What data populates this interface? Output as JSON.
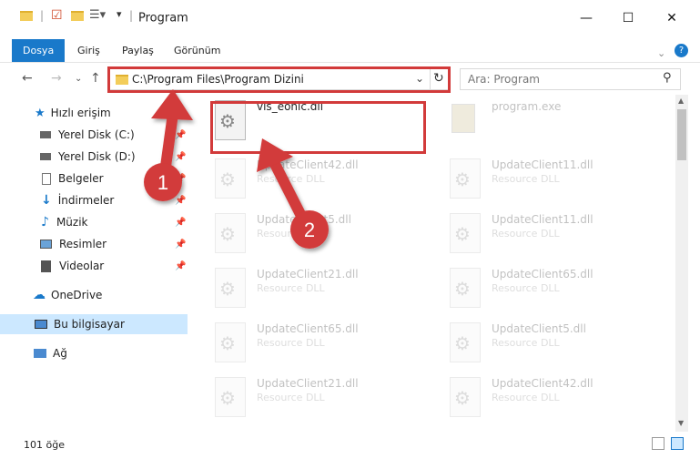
{
  "window": {
    "title": "Program",
    "minimize": "—",
    "maximize": "☐",
    "close": "✕"
  },
  "ribbon": {
    "tabs": [
      "Dosya",
      "Giriş",
      "Paylaş",
      "Görünüm"
    ],
    "help": "?"
  },
  "address": {
    "path": "C:\\Program Files\\Program Dizini",
    "refresh": "↻",
    "search_placeholder": "Ara: Program"
  },
  "sidebar": {
    "items": [
      {
        "label": "Hızlı erişim",
        "icon": "star-icon"
      },
      {
        "label": "Yerel Disk (C:)",
        "icon": "drive-icon",
        "pinned": true
      },
      {
        "label": "Yerel Disk (D:)",
        "icon": "drive-icon",
        "pinned": true
      },
      {
        "label": "Belgeler",
        "icon": "documents-icon",
        "pinned": true
      },
      {
        "label": "İndirmeler",
        "icon": "downloads-icon",
        "pinned": true
      },
      {
        "label": "Müzik",
        "icon": "music-icon",
        "pinned": true
      },
      {
        "label": "Resimler",
        "icon": "pictures-icon",
        "pinned": true
      },
      {
        "label": "Videolar",
        "icon": "videos-icon",
        "pinned": true
      },
      {
        "label": "OneDrive",
        "icon": "cloud-icon"
      },
      {
        "label": "Bu bilgisayar",
        "icon": "computer-icon",
        "selected": true
      },
      {
        "label": "Ağ",
        "icon": "network-icon"
      }
    ]
  },
  "files": [
    {
      "name": "vis_eonic.dll",
      "type": ""
    },
    {
      "name": "program.exe",
      "type": ""
    },
    {
      "name": "UpdateClient42.dll",
      "type": "Resource DLL"
    },
    {
      "name": "UpdateClient11.dll",
      "type": "Resource DLL"
    },
    {
      "name": "UpdateClient5.dll",
      "type": "Resource DLL"
    },
    {
      "name": "UpdateClient11.dll",
      "type": "Resource DLL"
    },
    {
      "name": "UpdateClient21.dll",
      "type": "Resource DLL"
    },
    {
      "name": "UpdateClient65.dll",
      "type": "Resource DLL"
    },
    {
      "name": "UpdateClient65.dll",
      "type": "Resource DLL"
    },
    {
      "name": "UpdateClient5.dll",
      "type": "Resource DLL"
    },
    {
      "name": "UpdateClient21.dll",
      "type": "Resource DLL"
    },
    {
      "name": "UpdateClient42.dll",
      "type": "Resource DLL"
    }
  ],
  "annotations": {
    "step1": "1",
    "step2": "2",
    "color": "#d23a3a"
  },
  "status": {
    "count": "101 öğe"
  }
}
